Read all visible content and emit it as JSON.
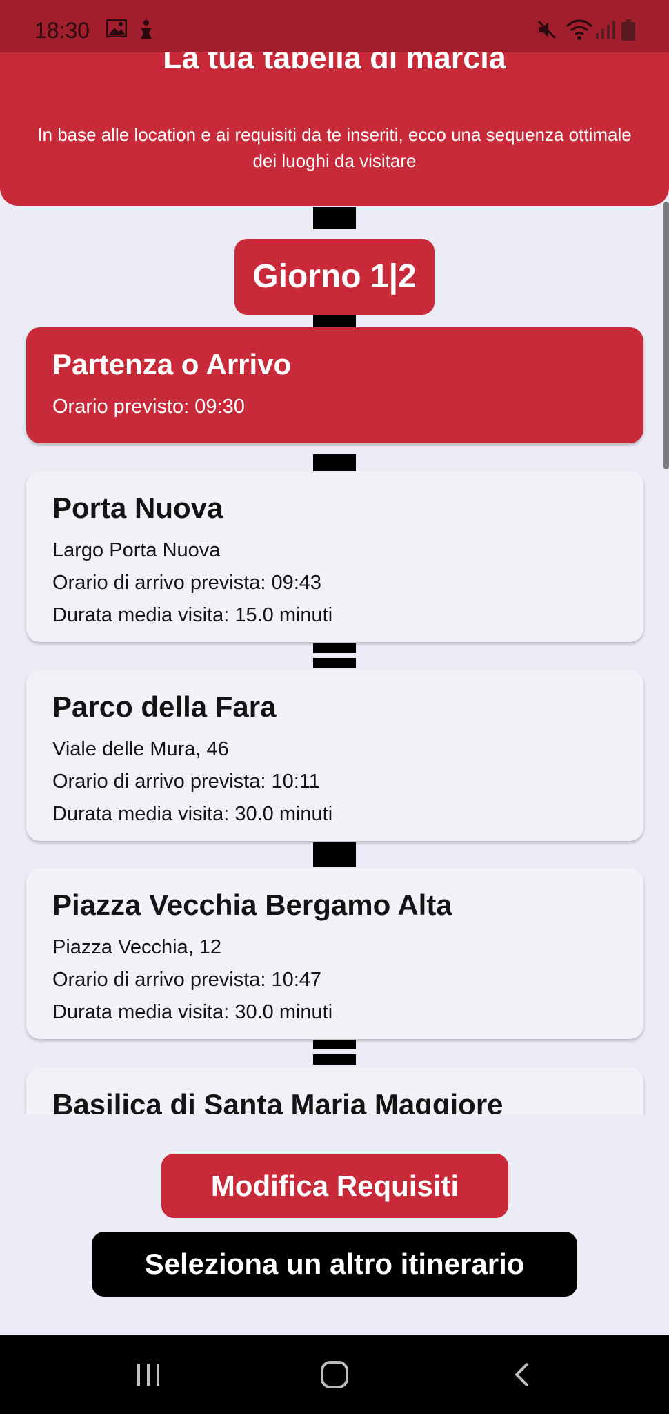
{
  "status_bar": {
    "time": "18:30"
  },
  "header": {
    "title": "La tua tabella di marcia",
    "subtitle": "In base alle location e ai requisiti da te inseriti, ecco una sequenza ottimale dei luoghi da visitare"
  },
  "day_badge": "Giorno 1|2",
  "start_card": {
    "title": "Partenza o Arrivo",
    "time": "Orario previsto: 09:30"
  },
  "stops": [
    {
      "name": "Porta Nuova",
      "address": "Largo Porta Nuova",
      "arrival": "Orario di arrivo prevista: 09:43",
      "duration": "Durata media visita: 15.0 minuti"
    },
    {
      "name": "Parco della Fara",
      "address": "Viale delle Mura, 46",
      "arrival": "Orario di arrivo prevista: 10:11",
      "duration": "Durata media visita: 30.0 minuti"
    },
    {
      "name": "Piazza Vecchia Bergamo Alta",
      "address": "Piazza Vecchia, 12",
      "arrival": "Orario di arrivo prevista: 10:47",
      "duration": "Durata media visita: 30.0 minuti"
    },
    {
      "name": "Basilica di Santa Maria Maggiore"
    }
  ],
  "buttons": {
    "modify": "Modifica Requisiti",
    "select_other": "Seleziona un altro itinerario"
  },
  "colors": {
    "accent": "#C92A39",
    "background": "#ECECF6",
    "card": "#F4F0F8"
  }
}
